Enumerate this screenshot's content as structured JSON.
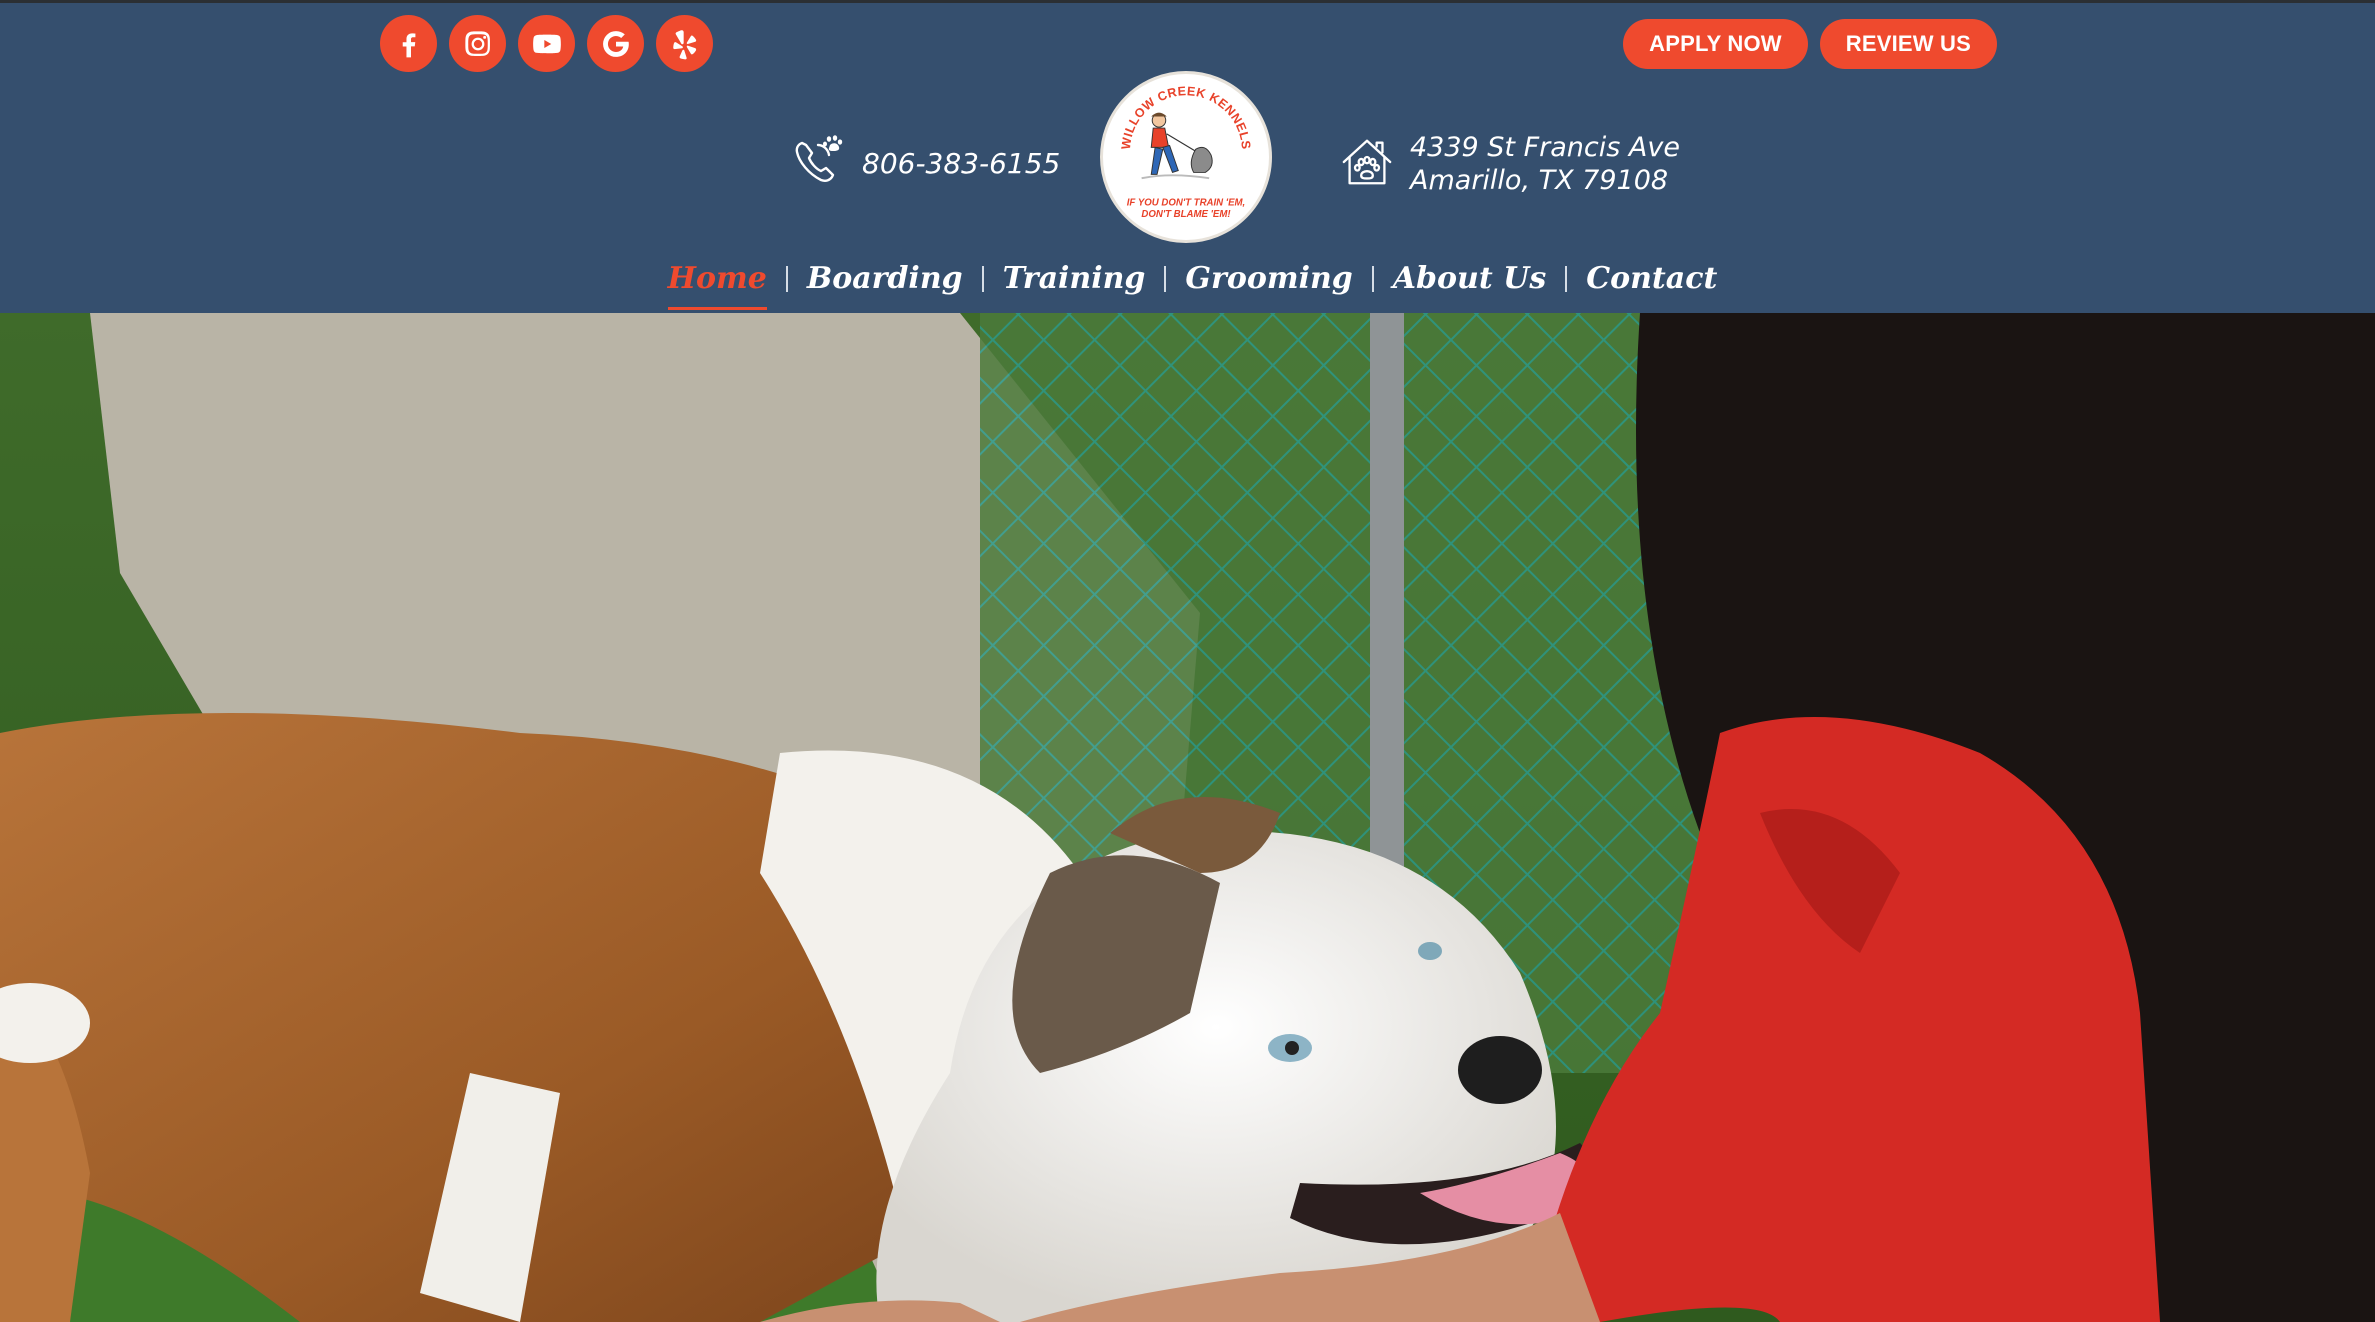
{
  "social": {
    "items": [
      {
        "name": "facebook",
        "icon": "facebook-icon"
      },
      {
        "name": "instagram",
        "icon": "instagram-icon"
      },
      {
        "name": "youtube",
        "icon": "youtube-icon"
      },
      {
        "name": "google",
        "icon": "google-icon"
      },
      {
        "name": "yelp",
        "icon": "yelp-icon"
      }
    ]
  },
  "cta": {
    "apply_label": "APPLY NOW",
    "review_label": "REVIEW US"
  },
  "contact": {
    "phone": "806-383-6155",
    "address_line1": "4339 St Francis Ave",
    "address_line2": "Amarillo, TX 79108"
  },
  "logo": {
    "arc_text": "WILLOW CREEK KENNELS",
    "tagline_line1": "IF YOU DON'T TRAIN 'EM,",
    "tagline_line2": "DON'T BLAME 'EM!"
  },
  "nav": {
    "items": [
      {
        "label": "Home",
        "active": true
      },
      {
        "label": "Boarding",
        "active": false
      },
      {
        "label": "Training",
        "active": false
      },
      {
        "label": "Grooming",
        "active": false
      },
      {
        "label": "About Us",
        "active": false
      },
      {
        "label": "Contact",
        "active": false
      }
    ]
  },
  "colors": {
    "header_bg": "#354f6e",
    "accent": "#ef4a2e",
    "nav_text": "#ffffff"
  }
}
